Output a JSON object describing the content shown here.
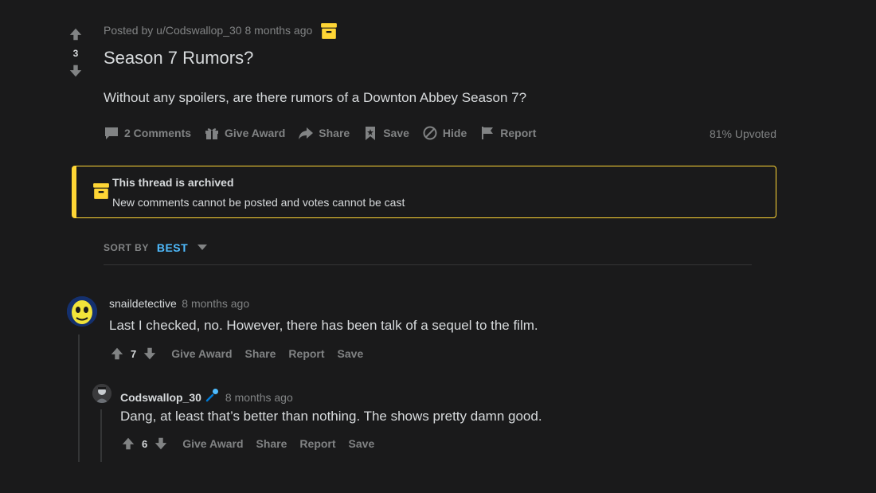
{
  "post": {
    "score": "3",
    "meta": "Posted by u/Codswallop_30 8 months ago",
    "title": "Season 7 Rumors?",
    "body": "Without any spoilers, are there rumors of a Downton Abbey Season 7?",
    "actions": {
      "comments": "2 Comments",
      "give_award": "Give Award",
      "share": "Share",
      "save": "Save",
      "hide": "Hide",
      "report": "Report"
    },
    "upvoted": "81% Upvoted"
  },
  "archived": {
    "title": "This thread is archived",
    "text": "New comments cannot be posted and votes cannot be cast"
  },
  "sort": {
    "label": "SORT BY",
    "value": "BEST"
  },
  "comments": [
    {
      "username": "snaildetective",
      "time": "8 months ago",
      "text": "Last I checked, no. However, there has been talk of a sequel to the film.",
      "score": "7",
      "actions": [
        "Give Award",
        "Share",
        "Report",
        "Save"
      ]
    },
    {
      "username": "Codswallop_30",
      "time": "8 months ago",
      "text": "Dang, at least that’s better than nothing. The shows pretty damn good.",
      "score": "6",
      "actions": [
        "Give Award",
        "Share",
        "Report",
        "Save"
      ]
    }
  ],
  "colors": {
    "background": "#1a1a1b",
    "text": "#d7dadc",
    "muted": "#818384",
    "archive_yellow": "#ffd635",
    "sort_blue": "#4fbcff",
    "op_mic_blue": "#0079d3"
  },
  "icons": {
    "upvote": "arrow-up-icon",
    "downvote": "arrow-down-icon",
    "archive": "archive-box-icon",
    "comments": "comment-bubble-icon",
    "award": "gift-icon",
    "share": "share-arrow-icon",
    "save": "bookmark-icon",
    "hide": "hide-circle-slash-icon",
    "report": "flag-icon",
    "sort": "caret-down-icon",
    "op": "microphone-icon"
  }
}
